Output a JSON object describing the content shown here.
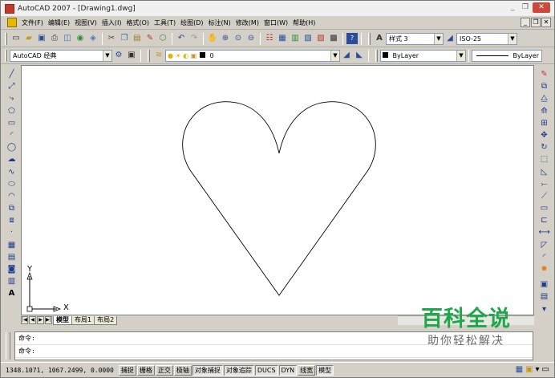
{
  "window": {
    "title": "AutoCAD 2007 - [Drawing1.dwg]",
    "minimize": "_",
    "restore": "❐",
    "close": "✕"
  },
  "menu": {
    "items": [
      "文件(F)",
      "编辑(E)",
      "视图(V)",
      "插入(I)",
      "格式(O)",
      "工具(T)",
      "绘图(D)",
      "标注(N)",
      "修改(M)",
      "窗口(W)",
      "帮助(H)"
    ],
    "mdi_minimize": "_",
    "mdi_restore": "❐",
    "mdi_close": "✕"
  },
  "toolbar_standard": {
    "text_style": "样式 3",
    "dim_style": "ISO-25"
  },
  "toolbar_workspace": {
    "workspace": "AutoCAD 经典",
    "layer": "0",
    "color": "ByLayer",
    "linetype": "ByLayer"
  },
  "canvas": {
    "axis_y": "Y",
    "axis_x": "X"
  },
  "layout_tabs": {
    "nav": [
      "|◀",
      "◀",
      "▶",
      "▶|"
    ],
    "tabs": [
      "模型",
      "布局1",
      "布局2"
    ]
  },
  "command": {
    "line1": "命令:",
    "line2": "命令:"
  },
  "status": {
    "coords": "1348.1071, 1067.2499, 0.0000",
    "buttons": [
      "捕捉",
      "栅格",
      "正交",
      "极轴",
      "对象捕捉",
      "对象追踪",
      "DUCS",
      "DYN",
      "线宽",
      "模型"
    ]
  },
  "watermark": {
    "main": "百科全说",
    "sub": "助你轻松解决"
  },
  "colors": {
    "watermark_green": "#1ea84b",
    "canvas_bg": "#ffffff",
    "chrome": "#d4d0c8"
  }
}
